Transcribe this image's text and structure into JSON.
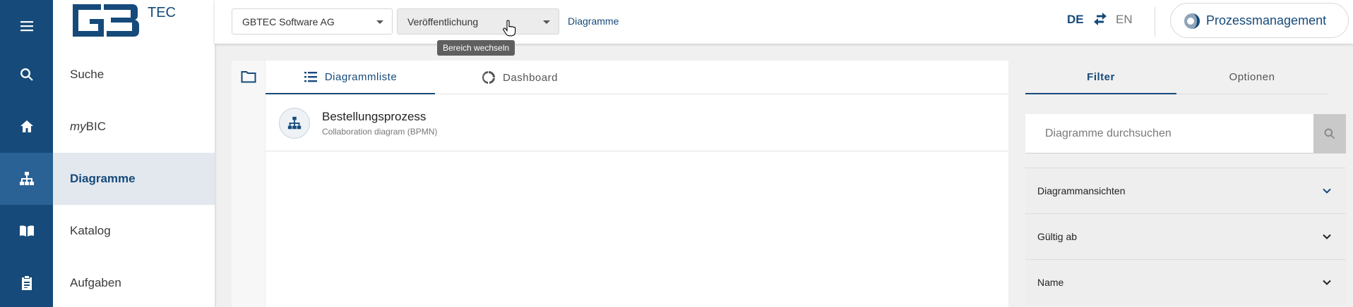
{
  "rail": {
    "items": [
      "menu-icon",
      "search-icon",
      "home-icon",
      "sitemap-icon",
      "book-icon",
      "clipboard-icon"
    ],
    "active_index": 3
  },
  "logo": {
    "text": "TEC"
  },
  "nav": {
    "items": [
      {
        "label": "Suche"
      },
      {
        "prefix": "my",
        "label": "BIC"
      },
      {
        "label": "Diagramme"
      },
      {
        "label": "Katalog"
      },
      {
        "label": "Aufgaben"
      }
    ],
    "active_index": 2
  },
  "topbar": {
    "org_select": "GBTEC Software AG",
    "stage_select": "Veröffentlichung",
    "breadcrumb": "Diagramme",
    "tooltip": "Bereich wechseln",
    "lang_de": "DE",
    "lang_en": "EN",
    "active_lang": "DE",
    "module": "Prozessmanagement"
  },
  "main": {
    "tabs": [
      {
        "label": "Diagrammliste",
        "icon": "list-icon",
        "active": true
      },
      {
        "label": "Dashboard",
        "icon": "dashboard-icon",
        "active": false
      }
    ],
    "rows": [
      {
        "title": "Bestellungsprozess",
        "subtitle": "Collaboration diagram (BPMN)",
        "icon": "sitemap-icon"
      }
    ]
  },
  "filter": {
    "tabs": [
      {
        "label": "Filter",
        "active": true
      },
      {
        "label": "Optionen",
        "active": false
      }
    ],
    "search_placeholder": "Diagramme durchsuchen",
    "search_value": "",
    "accordions": [
      "Diagrammansichten",
      "Gültig ab",
      "Name"
    ]
  },
  "colors": {
    "primary": "#164a7a",
    "rail_active": "#2a6296",
    "nav_active_bg": "#e3e8ef",
    "page_bg": "#f0f0f0"
  }
}
